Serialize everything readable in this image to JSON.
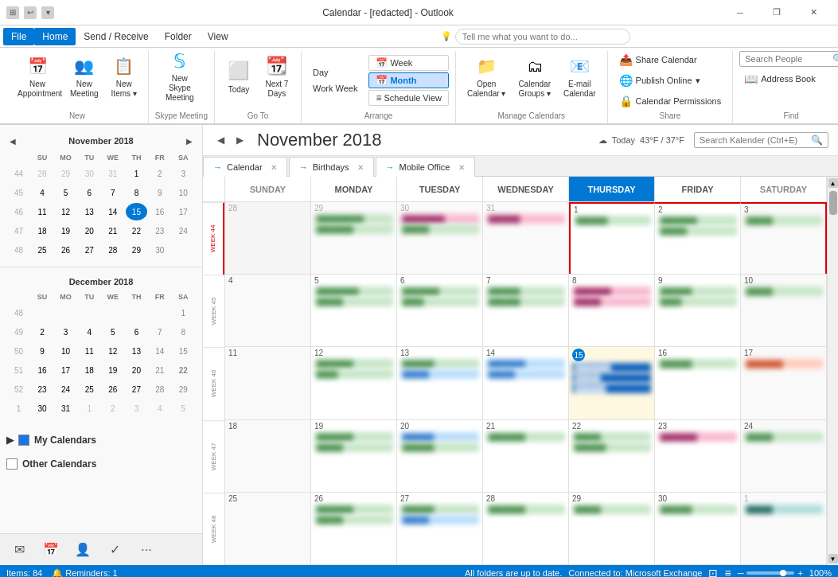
{
  "titleBar": {
    "title": "Calendar - [redacted] - Outlook",
    "icons": [
      "quick-access-1",
      "undo",
      "customize"
    ],
    "controls": [
      "minimize",
      "restore",
      "close"
    ]
  },
  "menuBar": {
    "items": [
      "File",
      "Home",
      "Send / Receive",
      "Folder",
      "View"
    ],
    "activeItem": "Home",
    "tellMe": "Tell me what you want to do..."
  },
  "ribbon": {
    "groups": {
      "new": {
        "label": "New",
        "buttons": [
          {
            "id": "new-appointment",
            "label": "New\nAppointment",
            "icon": "📅"
          },
          {
            "id": "new-meeting",
            "label": "New\nMeeting",
            "icon": "👥"
          },
          {
            "id": "new-items",
            "label": "New\nItems",
            "icon": "📋"
          }
        ]
      },
      "skype": {
        "label": "Skype Meeting",
        "buttons": [
          {
            "id": "new-skype-meeting",
            "label": "New Skype\nMeeting",
            "icon": "💬"
          }
        ]
      },
      "goto": {
        "label": "Go To",
        "buttons": [
          {
            "id": "today",
            "label": "Today",
            "icon": "◀"
          },
          {
            "id": "next7days",
            "label": "Next 7\nDays",
            "icon": "▶"
          }
        ]
      },
      "arrange": {
        "label": "Arrange",
        "views": [
          "Day",
          "Work Week",
          "Week",
          "Month",
          "Schedule View"
        ]
      },
      "manage": {
        "label": "Manage Calendars",
        "buttons": [
          {
            "id": "open-calendar",
            "label": "Open\nCalendar",
            "icon": "📁"
          },
          {
            "id": "calendar-groups",
            "label": "Calendar\nGroups",
            "icon": "🗂"
          },
          {
            "id": "email-calendar",
            "label": "E-mail\nCalendar",
            "icon": "📧"
          }
        ]
      },
      "share": {
        "label": "Share",
        "buttons": [
          {
            "id": "share-calendar",
            "label": "Share Calendar",
            "icon": "📤"
          },
          {
            "id": "publish-online",
            "label": "Publish Online",
            "icon": "🌐"
          },
          {
            "id": "calendar-permissions",
            "label": "Calendar Permissions",
            "icon": "🔒"
          }
        ]
      },
      "find": {
        "label": "Find",
        "buttons": [
          {
            "id": "search-people",
            "label": "Search People",
            "icon": "🔍"
          },
          {
            "id": "address-book",
            "label": "Address Book",
            "icon": "📖"
          }
        ],
        "searchPlaceholder": "Search People"
      }
    }
  },
  "miniCalendars": [
    {
      "month": "November 2018",
      "weekdays": [
        "SU",
        "MO",
        "TU",
        "WE",
        "TH",
        "FR",
        "SA"
      ],
      "weeks": [
        {
          "num": "44",
          "days": [
            {
              "n": "28",
              "prev": true
            },
            {
              "n": "29",
              "prev": true
            },
            {
              "n": "30",
              "prev": true
            },
            {
              "n": "31",
              "prev": true
            },
            {
              "n": "1"
            },
            {
              "n": "2"
            },
            {
              "n": "3"
            }
          ]
        },
        {
          "num": "45",
          "days": [
            {
              "n": "4"
            },
            {
              "n": "5"
            },
            {
              "n": "6"
            },
            {
              "n": "7"
            },
            {
              "n": "8"
            },
            {
              "n": "9"
            },
            {
              "n": "10"
            }
          ]
        },
        {
          "num": "46",
          "days": [
            {
              "n": "11"
            },
            {
              "n": "12"
            },
            {
              "n": "13"
            },
            {
              "n": "14"
            },
            {
              "n": "15",
              "today": true
            },
            {
              "n": "16"
            },
            {
              "n": "17"
            }
          ]
        },
        {
          "num": "47",
          "days": [
            {
              "n": "18"
            },
            {
              "n": "19"
            },
            {
              "n": "20"
            },
            {
              "n": "21"
            },
            {
              "n": "22"
            },
            {
              "n": "23"
            },
            {
              "n": "24"
            }
          ]
        },
        {
          "num": "48",
          "days": [
            {
              "n": "25"
            },
            {
              "n": "26"
            },
            {
              "n": "27"
            },
            {
              "n": "28"
            },
            {
              "n": "29"
            },
            {
              "n": "30",
              "last": true
            },
            {
              "n": ""
            }
          ]
        }
      ]
    },
    {
      "month": "December 2018",
      "weekdays": [
        "SU",
        "MO",
        "TU",
        "WE",
        "TH",
        "FR",
        "SA"
      ],
      "weeks": [
        {
          "num": "48",
          "days": [
            {
              "n": ""
            },
            {
              "n": ""
            },
            {
              "n": ""
            },
            {
              "n": ""
            },
            {
              "n": ""
            },
            {
              "n": ""
            },
            {
              "n": "1"
            }
          ]
        },
        {
          "num": "49",
          "days": [
            {
              "n": "2"
            },
            {
              "n": "3"
            },
            {
              "n": "4"
            },
            {
              "n": "5"
            },
            {
              "n": "6"
            },
            {
              "n": "7"
            },
            {
              "n": "8"
            }
          ]
        },
        {
          "num": "50",
          "days": [
            {
              "n": "9"
            },
            {
              "n": "10"
            },
            {
              "n": "11"
            },
            {
              "n": "12"
            },
            {
              "n": "13"
            },
            {
              "n": "14"
            },
            {
              "n": "15"
            }
          ]
        },
        {
          "num": "51",
          "days": [
            {
              "n": "16"
            },
            {
              "n": "17"
            },
            {
              "n": "18"
            },
            {
              "n": "19"
            },
            {
              "n": "20"
            },
            {
              "n": "21"
            },
            {
              "n": "22"
            }
          ]
        },
        {
          "num": "52",
          "days": [
            {
              "n": "23"
            },
            {
              "n": "24"
            },
            {
              "n": "25"
            },
            {
              "n": "26"
            },
            {
              "n": "27"
            },
            {
              "n": "28"
            },
            {
              "n": "29"
            }
          ]
        },
        {
          "num": "1",
          "days": [
            {
              "n": "30"
            },
            {
              "n": "31"
            },
            {
              "n": "1",
              "next": true
            },
            {
              "n": "2",
              "next": true
            },
            {
              "n": "3",
              "next": true
            },
            {
              "n": "4",
              "next": true
            },
            {
              "n": "5",
              "next": true
            }
          ]
        }
      ]
    }
  ],
  "sidebar": {
    "myCalendars": {
      "label": "My Calendars",
      "expanded": true,
      "items": []
    },
    "otherCalendars": {
      "label": "Other Calendars",
      "checked": false
    }
  },
  "navBar": {
    "items": [
      {
        "id": "mail",
        "icon": "✉",
        "label": "Mail"
      },
      {
        "id": "calendar",
        "icon": "📅",
        "label": "Calendar",
        "active": true
      },
      {
        "id": "people",
        "icon": "👤",
        "label": "People"
      },
      {
        "id": "tasks",
        "icon": "✓",
        "label": "Tasks"
      },
      {
        "id": "more",
        "icon": "•••",
        "label": "More"
      }
    ]
  },
  "calendarView": {
    "month": "November 2018",
    "weather": {
      "icon": "☁",
      "label": "Today",
      "temp": "43°F / 37°F"
    },
    "searchPlaceholder": "Search Kalender (Ctrl+E)",
    "tabs": [
      {
        "id": "calendar",
        "label": "Calendar",
        "icon": "→",
        "active": true
      },
      {
        "id": "birthdays",
        "label": "Birthdays",
        "icon": "→",
        "type": "birthdays"
      },
      {
        "id": "mobile-office",
        "label": "Mobile Office",
        "icon": "→",
        "type": "mobile"
      }
    ],
    "dayHeaders": [
      "SUNDAY",
      "MONDAY",
      "TUESDAY",
      "WEDNESDAY",
      "THURSDAY",
      "FRIDAY",
      "SATURDAY"
    ],
    "weekLabels": [
      "WEEK 44",
      "WEEK 45",
      "WEEK 46",
      "WEEK 47",
      "WEEK 48"
    ],
    "weeks": [
      {
        "label": "WEEK 44",
        "days": [
          {
            "num": "28",
            "prevMonth": true,
            "events": []
          },
          {
            "num": "29",
            "prevMonth": true,
            "events": [
              {
                "text": "blurred event",
                "color": "green"
              },
              {
                "text": "blurred event",
                "color": "green"
              }
            ]
          },
          {
            "num": "30",
            "prevMonth": true,
            "events": [
              {
                "text": "blurred event",
                "color": "pink"
              },
              {
                "text": "blurred event",
                "color": "green"
              }
            ]
          },
          {
            "num": "31",
            "prevMonth": true,
            "events": [
              {
                "text": "blurred event",
                "color": "pink"
              }
            ]
          },
          {
            "num": "1",
            "events": [
              {
                "text": "blurred event",
                "color": "green"
              }
            ]
          },
          {
            "num": "2",
            "events": [
              {
                "text": "blurred event",
                "color": "green"
              },
              {
                "text": "blurred event",
                "color": "green"
              }
            ]
          },
          {
            "num": "3",
            "events": [
              {
                "text": "blurred event",
                "color": "green"
              }
            ]
          }
        ]
      },
      {
        "label": "WEEK 45",
        "days": [
          {
            "num": "4",
            "events": []
          },
          {
            "num": "5",
            "events": [
              {
                "text": "blurred event",
                "color": "green"
              },
              {
                "text": "blurred event",
                "color": "green"
              }
            ]
          },
          {
            "num": "6",
            "events": [
              {
                "text": "blurred event",
                "color": "green"
              },
              {
                "text": "blurred event",
                "color": "green"
              }
            ]
          },
          {
            "num": "7",
            "events": [
              {
                "text": "blurred event",
                "color": "green"
              },
              {
                "text": "blurred event",
                "color": "green"
              }
            ]
          },
          {
            "num": "8",
            "events": [
              {
                "text": "blurred event",
                "color": "pink"
              },
              {
                "text": "blurred event",
                "color": "pink"
              }
            ]
          },
          {
            "num": "9",
            "events": [
              {
                "text": "blurred event",
                "color": "green"
              },
              {
                "text": "blurred event",
                "color": "green"
              }
            ]
          },
          {
            "num": "10",
            "events": [
              {
                "text": "blurred event",
                "color": "green"
              }
            ]
          }
        ]
      },
      {
        "label": "WEEK 46",
        "days": [
          {
            "num": "11",
            "events": []
          },
          {
            "num": "12",
            "events": [
              {
                "text": "blurred event",
                "color": "green"
              },
              {
                "text": "blurred event",
                "color": "green"
              }
            ]
          },
          {
            "num": "13",
            "events": [
              {
                "text": "blurred event",
                "color": "green"
              },
              {
                "text": "blurred event",
                "color": "green"
              }
            ]
          },
          {
            "num": "14",
            "events": [
              {
                "text": "blurred event",
                "color": "blue"
              },
              {
                "text": "blurred event",
                "color": "blue"
              }
            ]
          },
          {
            "num": "15",
            "today": true,
            "events": [
              {
                "text": "blurred event",
                "color": "dark-blue"
              },
              {
                "text": "blurred event",
                "color": "dark-blue"
              },
              {
                "text": "blurred event",
                "color": "dark-blue"
              }
            ]
          },
          {
            "num": "16",
            "events": [
              {
                "text": "blurred event",
                "color": "green"
              }
            ]
          },
          {
            "num": "17",
            "events": [
              {
                "text": "blurred event",
                "color": "salmon"
              }
            ]
          }
        ]
      },
      {
        "label": "WEEK 47",
        "days": [
          {
            "num": "18",
            "events": []
          },
          {
            "num": "19",
            "events": [
              {
                "text": "blurred event",
                "color": "green"
              },
              {
                "text": "blurred event",
                "color": "green"
              }
            ]
          },
          {
            "num": "20",
            "events": [
              {
                "text": "blurred event",
                "color": "blue"
              },
              {
                "text": "blurred event",
                "color": "green"
              }
            ]
          },
          {
            "num": "21",
            "events": [
              {
                "text": "blurred event",
                "color": "green"
              }
            ]
          },
          {
            "num": "22",
            "events": [
              {
                "text": "blurred event",
                "color": "green"
              },
              {
                "text": "blurred event",
                "color": "green"
              }
            ]
          },
          {
            "num": "23",
            "events": [
              {
                "text": "blurred event",
                "color": "pink"
              }
            ]
          },
          {
            "num": "24",
            "events": [
              {
                "text": "blurred event",
                "color": "green"
              }
            ]
          }
        ]
      },
      {
        "label": "WEEK 48",
        "days": [
          {
            "num": "25",
            "events": []
          },
          {
            "num": "26",
            "events": [
              {
                "text": "blurred event",
                "color": "green"
              },
              {
                "text": "blurred event",
                "color": "green"
              }
            ]
          },
          {
            "num": "27",
            "events": [
              {
                "text": "blurred event",
                "color": "green"
              },
              {
                "text": "blurred event",
                "color": "blue"
              }
            ]
          },
          {
            "num": "28",
            "events": [
              {
                "text": "blurred event",
                "color": "green"
              }
            ]
          },
          {
            "num": "29",
            "events": [
              {
                "text": "blurred event",
                "color": "green"
              }
            ]
          },
          {
            "num": "30",
            "events": [
              {
                "text": "blurred event",
                "color": "green"
              }
            ]
          },
          {
            "num": "1",
            "nextMonth": true,
            "events": [
              {
                "text": "blurred event",
                "color": "teal"
              }
            ]
          }
        ]
      }
    ]
  },
  "statusBar": {
    "items": "Items: 84",
    "reminders": "🔔 Reminders: 1",
    "syncStatus": "All folders are up to date.",
    "connection": "Connected to: Microsoft Exchange",
    "zoom": "100%"
  }
}
